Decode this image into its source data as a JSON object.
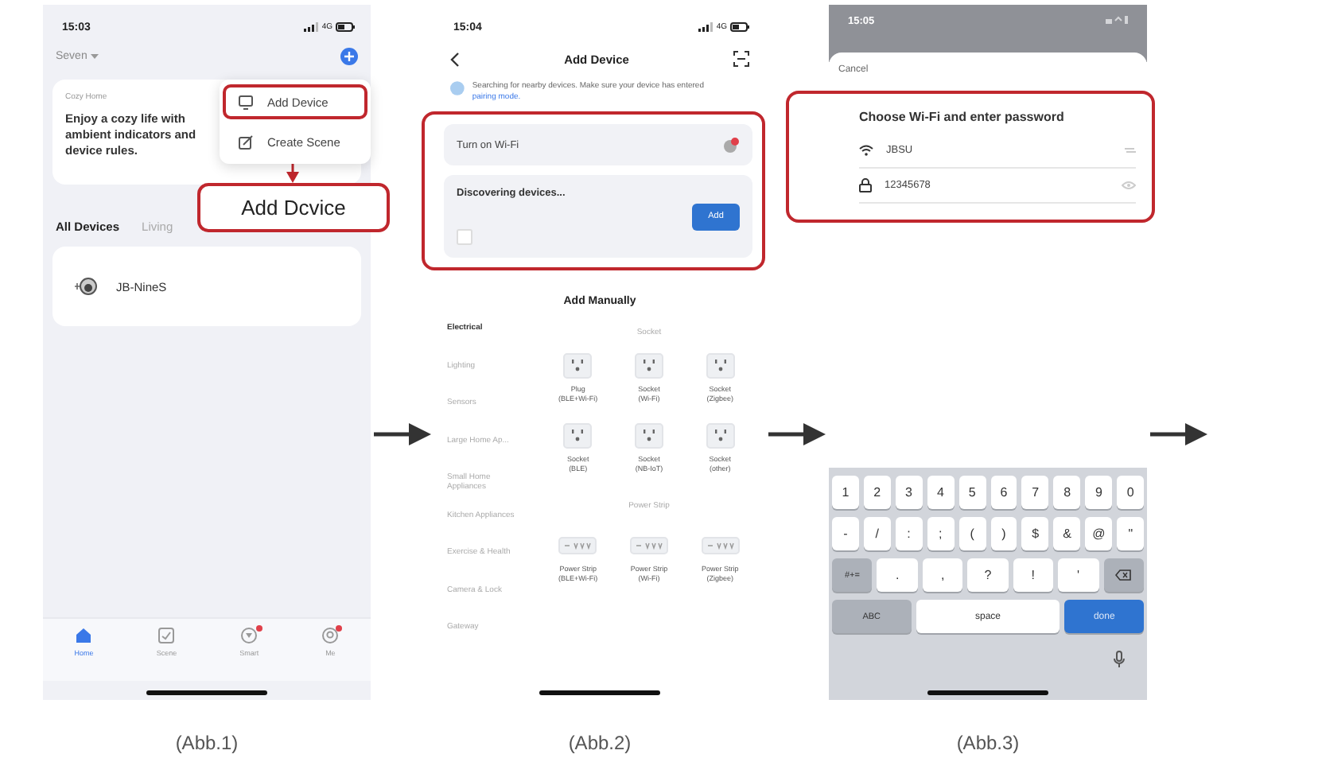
{
  "screens": [
    {
      "kind": "home",
      "caption": "(Abb.1)",
      "status": {
        "time": "15:03",
        "network": "4G"
      },
      "home_name": "Seven",
      "card": {
        "label": "Cozy Home",
        "text": "Enjoy a cozy life with ambient indicators and device rules."
      },
      "room_tabs": [
        {
          "label": "All Devices",
          "selected": true
        },
        {
          "label": "Living",
          "selected": false
        }
      ],
      "devices": [
        {
          "name": "JB-NineS"
        }
      ],
      "nav": [
        {
          "kind": "home",
          "label": "Home",
          "selected": true,
          "badge": false
        },
        {
          "kind": "scene",
          "label": "Scene",
          "selected": false,
          "badge": false
        },
        {
          "kind": "smart",
          "label": "Smart",
          "selected": false,
          "badge": true
        },
        {
          "kind": "me",
          "label": "Me",
          "selected": false,
          "badge": true
        }
      ],
      "menu": [
        {
          "kind": "add",
          "label": "Add Device",
          "highlighted": true
        },
        {
          "kind": "scene",
          "label": "Create Scene",
          "highlighted": false
        }
      ],
      "callout": "Add Dcvice"
    },
    {
      "kind": "add_device",
      "caption": "(Abb.2)",
      "status": {
        "time": "15:04",
        "network": "4G"
      },
      "title": "Add Device",
      "notice": {
        "text": "Searching for nearby devices. Make sure your device has entered",
        "link": "pairing mode."
      },
      "highlighted": true,
      "wifi_row": {
        "label": "Turn on Wi-Fi",
        "alert": true
      },
      "discovery": {
        "label": "Discovering devices...",
        "button": "Add"
      },
      "manual_title": "Add Manually",
      "categories": [
        {
          "label": "Electrical",
          "selected": true
        },
        {
          "label": "Lighting",
          "selected": false
        },
        {
          "label": "Sensors",
          "selected": false
        },
        {
          "label": "Large Home Ap...",
          "selected": false
        },
        {
          "label": "Small Home Appliances",
          "selected": false
        },
        {
          "label": "Kitchen Appliances",
          "selected": false
        },
        {
          "label": "Exercise & Health",
          "selected": false
        },
        {
          "label": "Camera & Lock",
          "selected": false
        },
        {
          "label": "Gateway",
          "selected": false
        }
      ],
      "groups": [
        {
          "title": "Socket",
          "products": [
            {
              "kind": "socket",
              "name": "Plug",
              "protocol": "(BLE+Wi-Fi)"
            },
            {
              "kind": "socket",
              "name": "Socket",
              "protocol": "(Wi-Fi)"
            },
            {
              "kind": "socket",
              "name": "Socket",
              "protocol": "(Zigbee)"
            },
            {
              "kind": "socket",
              "name": "Socket",
              "protocol": "(BLE)"
            },
            {
              "kind": "socket",
              "name": "Socket",
              "protocol": "(NB-IoT)"
            },
            {
              "kind": "socket",
              "name": "Socket",
              "protocol": "(other)"
            }
          ]
        },
        {
          "title": "Power Strip",
          "products": [
            {
              "kind": "strip",
              "name": "Power Strip",
              "protocol": "(BLE+Wi-Fi)"
            },
            {
              "kind": "strip",
              "name": "Power Strip",
              "protocol": "(Wi-Fi)"
            },
            {
              "kind": "strip",
              "name": "Power Strip",
              "protocol": "(Zigbee)"
            }
          ]
        }
      ]
    },
    {
      "kind": "wifi_password",
      "caption": "(Abb.3)",
      "status": {
        "time": "15:05"
      },
      "cancel": "Cancel",
      "heading": "Choose Wi-Fi and enter password",
      "highlighted": true,
      "network_name": "JBSU",
      "password": "12345678",
      "keyboard": [
        [
          {
            "kind": "char",
            "label": "1"
          },
          {
            "kind": "char",
            "label": "2"
          },
          {
            "kind": "char",
            "label": "3"
          },
          {
            "kind": "char",
            "label": "4"
          },
          {
            "kind": "char",
            "label": "5"
          },
          {
            "kind": "char",
            "label": "6"
          },
          {
            "kind": "char",
            "label": "7"
          },
          {
            "kind": "char",
            "label": "8"
          },
          {
            "kind": "char",
            "label": "9"
          },
          {
            "kind": "char",
            "label": "0"
          }
        ],
        [
          {
            "kind": "char",
            "label": "-"
          },
          {
            "kind": "char",
            "label": "/"
          },
          {
            "kind": "char",
            "label": ":"
          },
          {
            "kind": "char",
            "label": ";"
          },
          {
            "kind": "char",
            "label": "("
          },
          {
            "kind": "char",
            "label": ")"
          },
          {
            "kind": "char",
            "label": "$"
          },
          {
            "kind": "char",
            "label": "&"
          },
          {
            "kind": "char",
            "label": "@"
          },
          {
            "kind": "char",
            "label": "\""
          }
        ],
        [
          {
            "kind": "mode",
            "label": "#+="
          },
          {
            "kind": "char",
            "label": "."
          },
          {
            "kind": "char",
            "label": ","
          },
          {
            "kind": "char",
            "label": "?"
          },
          {
            "kind": "char",
            "label": "!"
          },
          {
            "kind": "char",
            "label": "'"
          },
          {
            "kind": "backspace"
          }
        ],
        [
          {
            "kind": "mode",
            "label": "ABC"
          },
          {
            "kind": "space",
            "label": "space"
          },
          {
            "kind": "done",
            "label": "done"
          }
        ]
      ]
    }
  ]
}
